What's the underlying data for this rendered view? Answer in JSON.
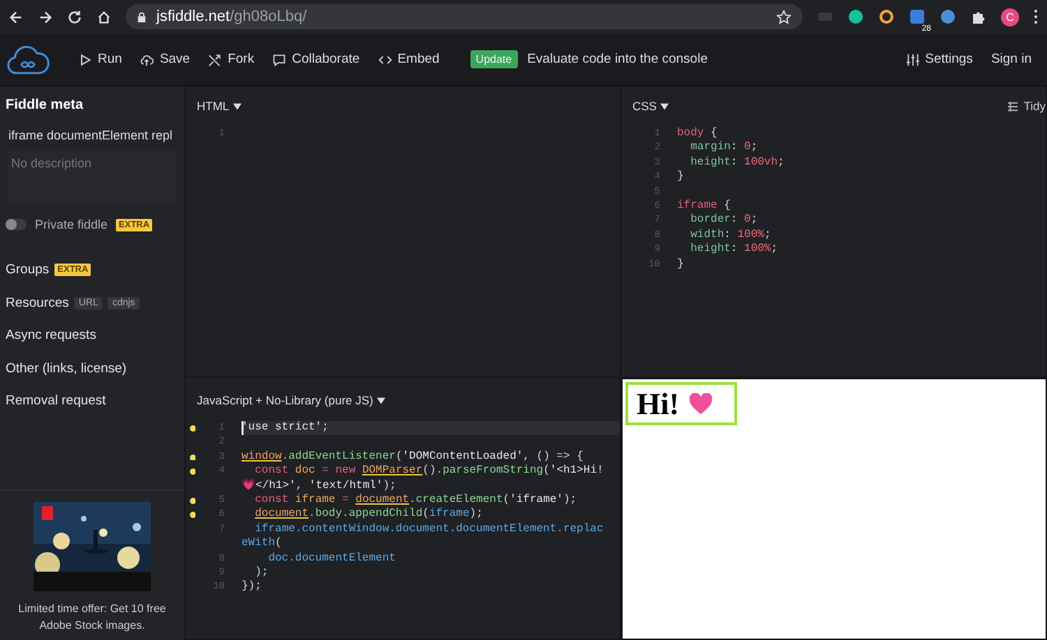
{
  "browser": {
    "url_host": "jsfiddle.net",
    "url_path": "/gh08oLbq/",
    "extension_badge": "28",
    "profile_initial": "C"
  },
  "toolbar": {
    "actions": [
      {
        "kind": "run",
        "label": "Run"
      },
      {
        "kind": "save",
        "label": "Save"
      },
      {
        "kind": "fork",
        "label": "Fork"
      },
      {
        "kind": "collaborate",
        "label": "Collaborate"
      },
      {
        "kind": "embed",
        "label": "Embed"
      }
    ],
    "update_badge": "Update",
    "update_text": "Evaluate code into the console",
    "settings": "Settings",
    "sign_in": "Sign in"
  },
  "sidebar": {
    "title": "Fiddle meta",
    "fiddle_title": "iframe documentElement repl",
    "description": {
      "placeholder": "No description"
    },
    "private": {
      "label": "Private fiddle",
      "on": false,
      "badge": "EXTRA"
    },
    "items": [
      {
        "label": "Groups",
        "badges": [
          {
            "kind": "extra",
            "text": "EXTRA"
          }
        ]
      },
      {
        "label": "Resources",
        "badges": [
          {
            "kind": "tag",
            "text": "URL"
          },
          {
            "kind": "tag",
            "text": "cdnjs"
          }
        ]
      },
      {
        "label": "Async requests"
      },
      {
        "label": "Other (links, license)"
      },
      {
        "label": "Removal request"
      }
    ],
    "ad": {
      "kind": "picture",
      "caption": "Limited time offer: Get 10 free Adobe Stock images."
    }
  },
  "html_panel": {
    "title": "HTML",
    "lines": [
      {
        "number": "1"
      }
    ]
  },
  "css_panel": {
    "title": "CSS",
    "tidy": "Tidy",
    "lines": [
      {
        "number": "1",
        "tokens": [
          {
            "kind": "selector",
            "text": "body"
          },
          {
            "kind": "plain",
            "text": " {"
          }
        ]
      },
      {
        "number": "2",
        "tokens": [
          {
            "kind": "prop",
            "text": "  margin"
          },
          {
            "kind": "plain",
            "text": ": "
          },
          {
            "kind": "value",
            "text": "0"
          },
          {
            "kind": "plain",
            "text": ";"
          }
        ]
      },
      {
        "number": "3",
        "tokens": [
          {
            "kind": "prop",
            "text": "  height"
          },
          {
            "kind": "plain",
            "text": ": "
          },
          {
            "kind": "value",
            "text": "100vh"
          },
          {
            "kind": "plain",
            "text": ";"
          }
        ]
      },
      {
        "number": "4",
        "tokens": [
          {
            "kind": "plain",
            "text": "}"
          }
        ]
      },
      {
        "number": "5"
      },
      {
        "number": "6",
        "tokens": [
          {
            "kind": "selector",
            "text": "iframe"
          },
          {
            "kind": "plain",
            "text": " {"
          }
        ]
      },
      {
        "number": "7",
        "tokens": [
          {
            "kind": "prop",
            "text": "  border"
          },
          {
            "kind": "plain",
            "text": ": "
          },
          {
            "kind": "value",
            "text": "0"
          },
          {
            "kind": "plain",
            "text": ";"
          }
        ]
      },
      {
        "number": "8",
        "tokens": [
          {
            "kind": "prop",
            "text": "  width"
          },
          {
            "kind": "plain",
            "text": ": "
          },
          {
            "kind": "value",
            "text": "100%"
          },
          {
            "kind": "plain",
            "text": ";"
          }
        ]
      },
      {
        "number": "9",
        "tokens": [
          {
            "kind": "prop",
            "text": "  height"
          },
          {
            "kind": "plain",
            "text": ": "
          },
          {
            "kind": "value",
            "text": "100%"
          },
          {
            "kind": "plain",
            "text": ";"
          }
        ]
      },
      {
        "number": "10",
        "tokens": [
          {
            "kind": "plain",
            "text": "}"
          }
        ]
      }
    ]
  },
  "js_panel": {
    "title": "JavaScript + No-Library (pure JS)",
    "lines": [
      {
        "number": "1",
        "warning": true,
        "active": true,
        "tokens": [
          {
            "kind": "str",
            "text": "'use strict'"
          },
          {
            "kind": "plain",
            "text": ";"
          }
        ]
      },
      {
        "number": "2",
        "warning": false,
        "active": false
      },
      {
        "number": "3",
        "warning": true,
        "active": false,
        "tokens": [
          {
            "kind": "flagged",
            "text": "window"
          },
          {
            "kind": "fn",
            "text": ".addEventListener"
          },
          {
            "kind": "plain",
            "text": "("
          },
          {
            "kind": "str",
            "text": "'DOMContentLoaded'"
          },
          {
            "kind": "plain",
            "text": ", () => {"
          }
        ]
      },
      {
        "number": "4",
        "warning": true,
        "active": false,
        "tokens": [
          {
            "kind": "keyword",
            "text": "  const "
          },
          {
            "kind": "var",
            "text": "doc"
          },
          {
            "kind": "keyword",
            "text": " = new "
          },
          {
            "kind": "flagged",
            "text": "DOMParser"
          },
          {
            "kind": "plain",
            "text": "()"
          },
          {
            "kind": "fn",
            "text": ".parseFromString"
          },
          {
            "kind": "plain",
            "text": "("
          },
          {
            "kind": "str",
            "text": "'<h1>Hi! 💗</h1>'"
          },
          {
            "kind": "plain",
            "text": ", "
          },
          {
            "kind": "str",
            "text": "'text/html'"
          },
          {
            "kind": "plain",
            "text": ");"
          }
        ]
      },
      {
        "number": "5",
        "warning": true,
        "active": false,
        "tokens": [
          {
            "kind": "keyword",
            "text": "  const "
          },
          {
            "kind": "var",
            "text": "iframe"
          },
          {
            "kind": "keyword",
            "text": " = "
          },
          {
            "kind": "flagged",
            "text": "document"
          },
          {
            "kind": "fn",
            "text": ".createElement"
          },
          {
            "kind": "plain",
            "text": "("
          },
          {
            "kind": "str",
            "text": "'iframe'"
          },
          {
            "kind": "plain",
            "text": ");"
          }
        ]
      },
      {
        "number": "6",
        "warning": true,
        "active": false,
        "tokens": [
          {
            "kind": "flagged",
            "text": "  document"
          },
          {
            "kind": "fn",
            "text": ".body.appendChild"
          },
          {
            "kind": "plain",
            "text": "("
          },
          {
            "kind": "ref",
            "text": "iframe"
          },
          {
            "kind": "plain",
            "text": ");"
          }
        ]
      },
      {
        "number": "7",
        "warning": false,
        "active": false,
        "tokens": [
          {
            "kind": "ref",
            "text": "  iframe.contentWindow.document.documentElement.replaceWith"
          },
          {
            "kind": "plain",
            "text": "("
          }
        ]
      },
      {
        "number": "8",
        "warning": false,
        "active": false,
        "tokens": [
          {
            "kind": "ref",
            "text": "    doc.documentElement"
          }
        ]
      },
      {
        "number": "9",
        "warning": false,
        "active": false,
        "tokens": [
          {
            "kind": "plain",
            "text": "  );"
          }
        ]
      },
      {
        "number": "10",
        "warning": false,
        "active": false,
        "tokens": [
          {
            "kind": "plain",
            "text": "});"
          }
        ]
      }
    ]
  },
  "result": {
    "heading": "Hi!"
  }
}
